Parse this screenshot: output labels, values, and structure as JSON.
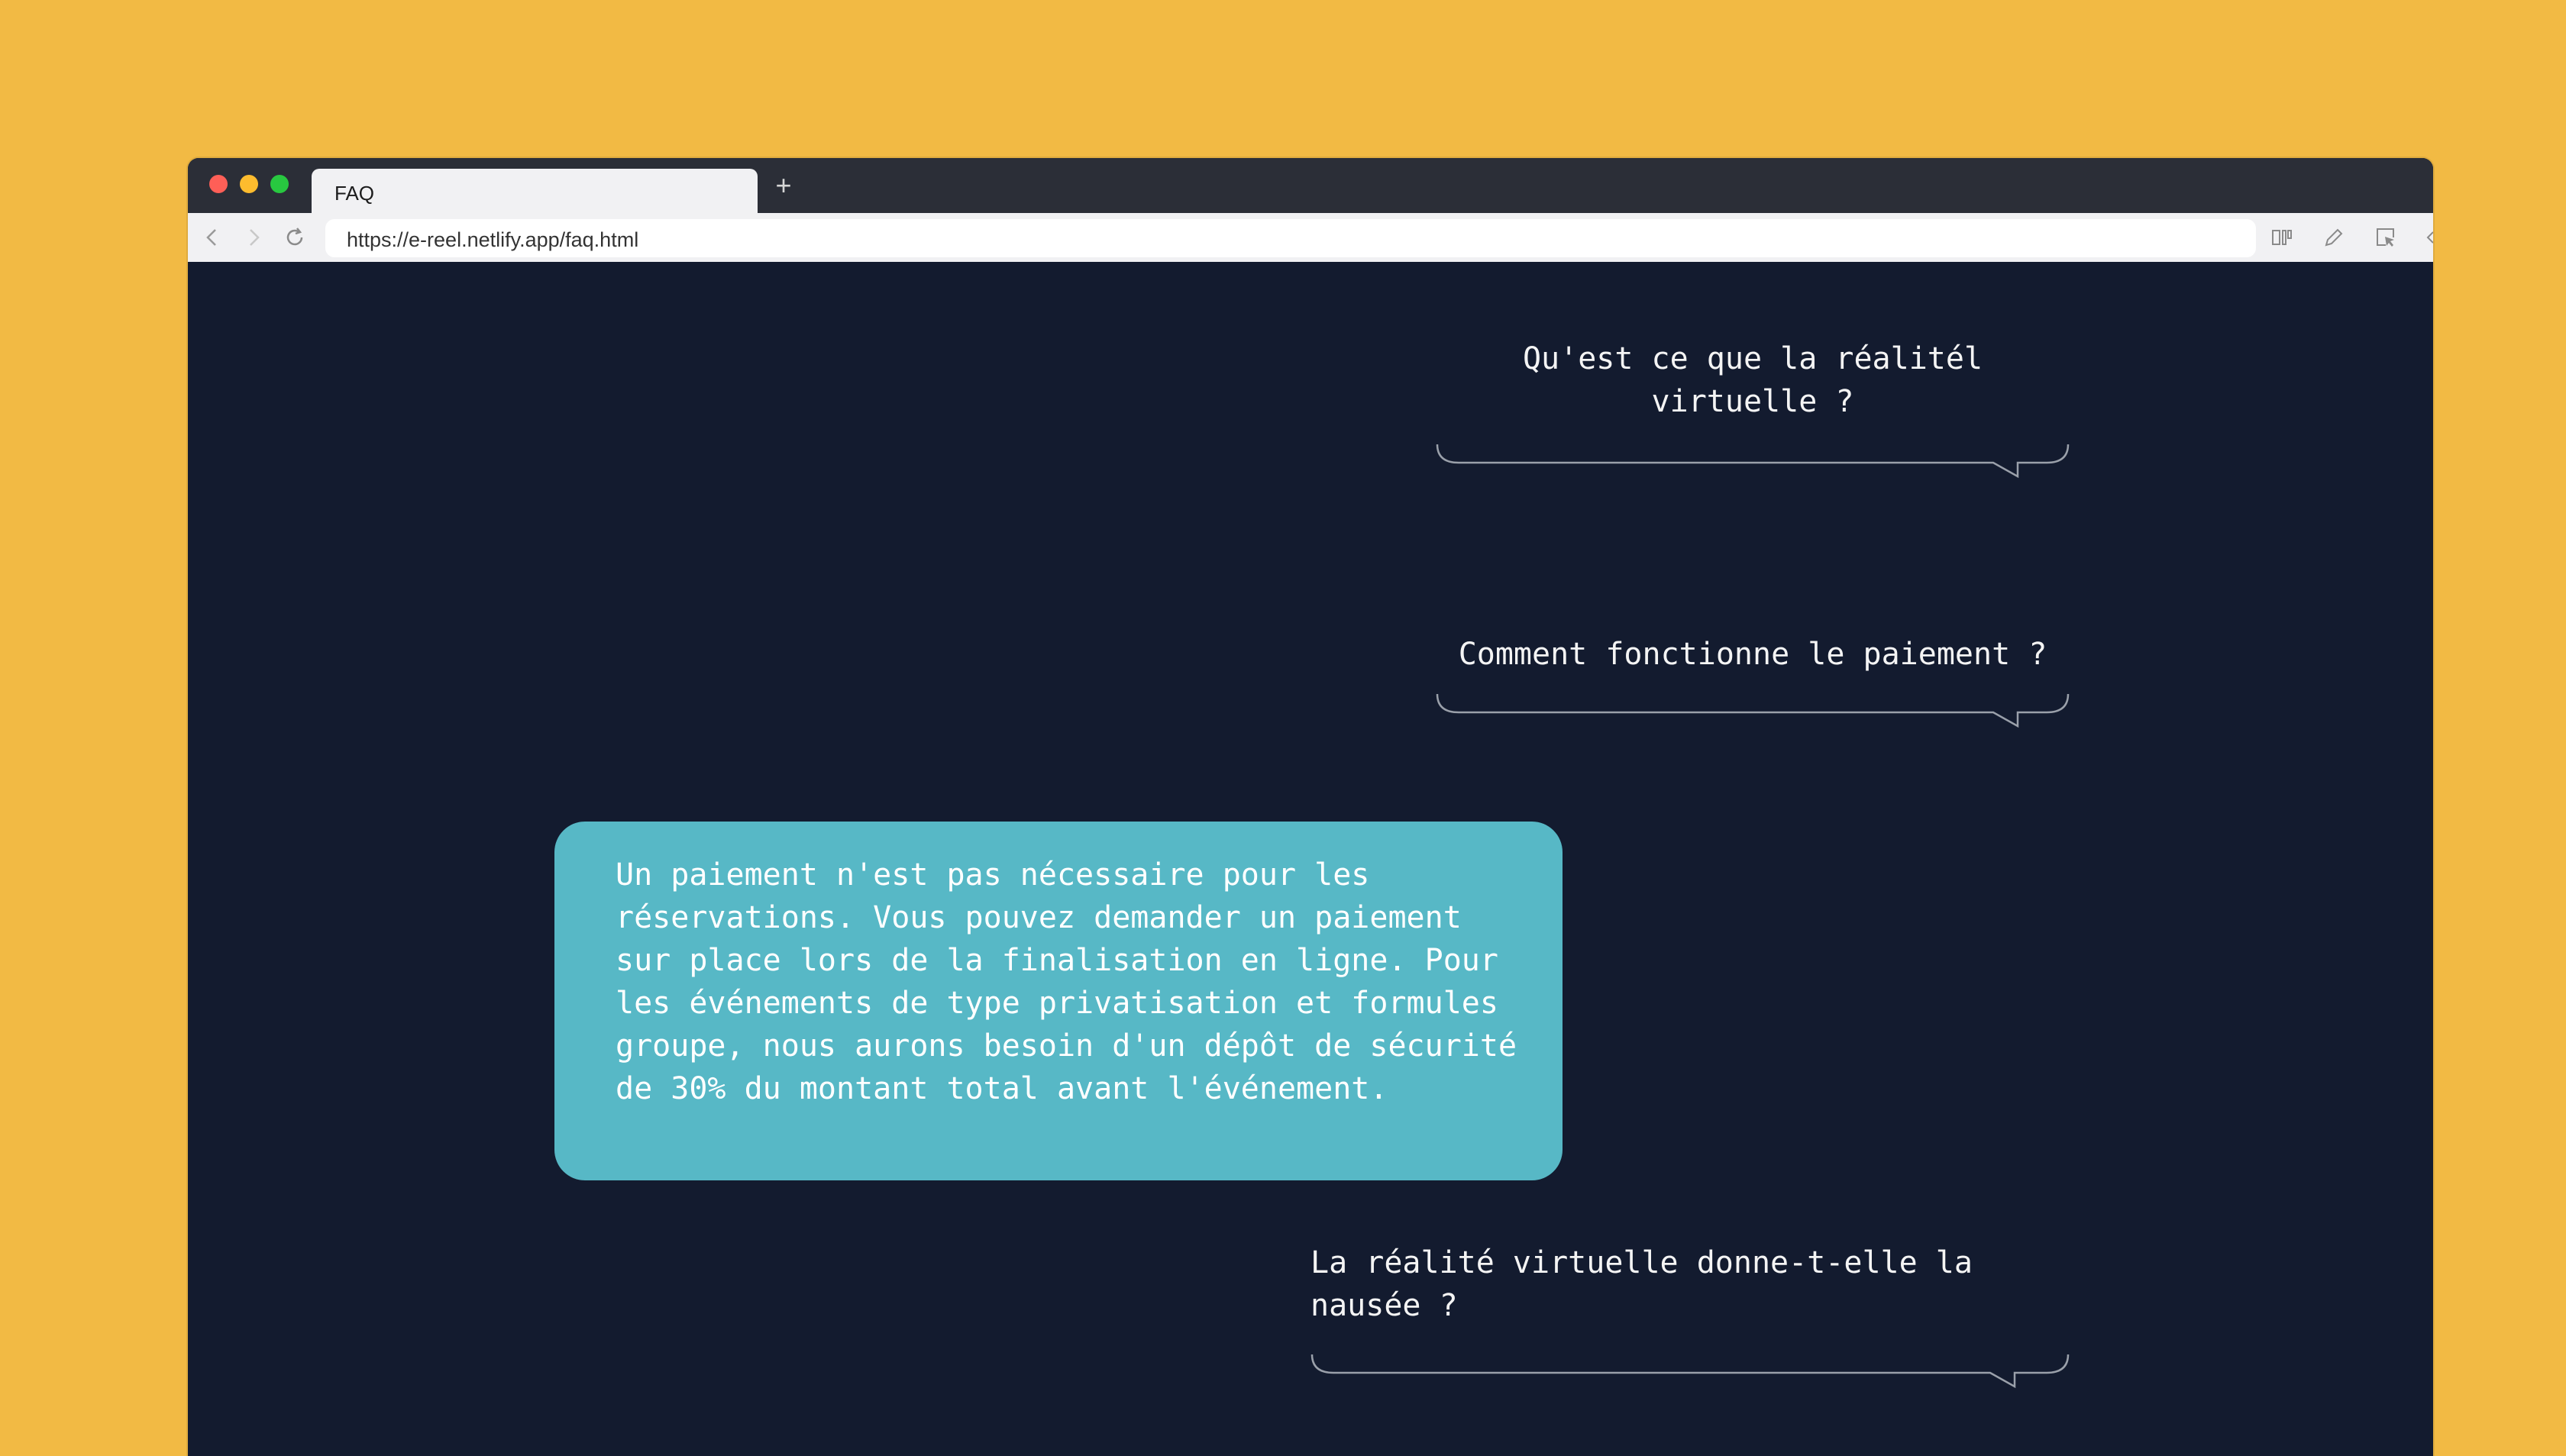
{
  "browser": {
    "tab_title": "FAQ",
    "new_tab_label": "+",
    "url": "https://e-reel.netlify.app/faq.html"
  },
  "faq": {
    "q1": "Qu'est ce que la réalitél virtuelle ?",
    "q2": "Comment fonctionne le paiement ?",
    "answer": "Un paiement n'est pas nécessaire pour les réservations. Vous pouvez demander un paiement sur place lors de la finalisation en ligne. Pour les événements de type privatisation et formules groupe, nous aurons besoin d'un dépôt de sécurité de 30% du montant total avant l'événement.",
    "q3": "La réalité virtuelle donne-t-elle la nausée ?"
  },
  "colors": {
    "background": "#F2BA44",
    "page": "#131B2F",
    "answer_bubble": "#57B8C6"
  }
}
